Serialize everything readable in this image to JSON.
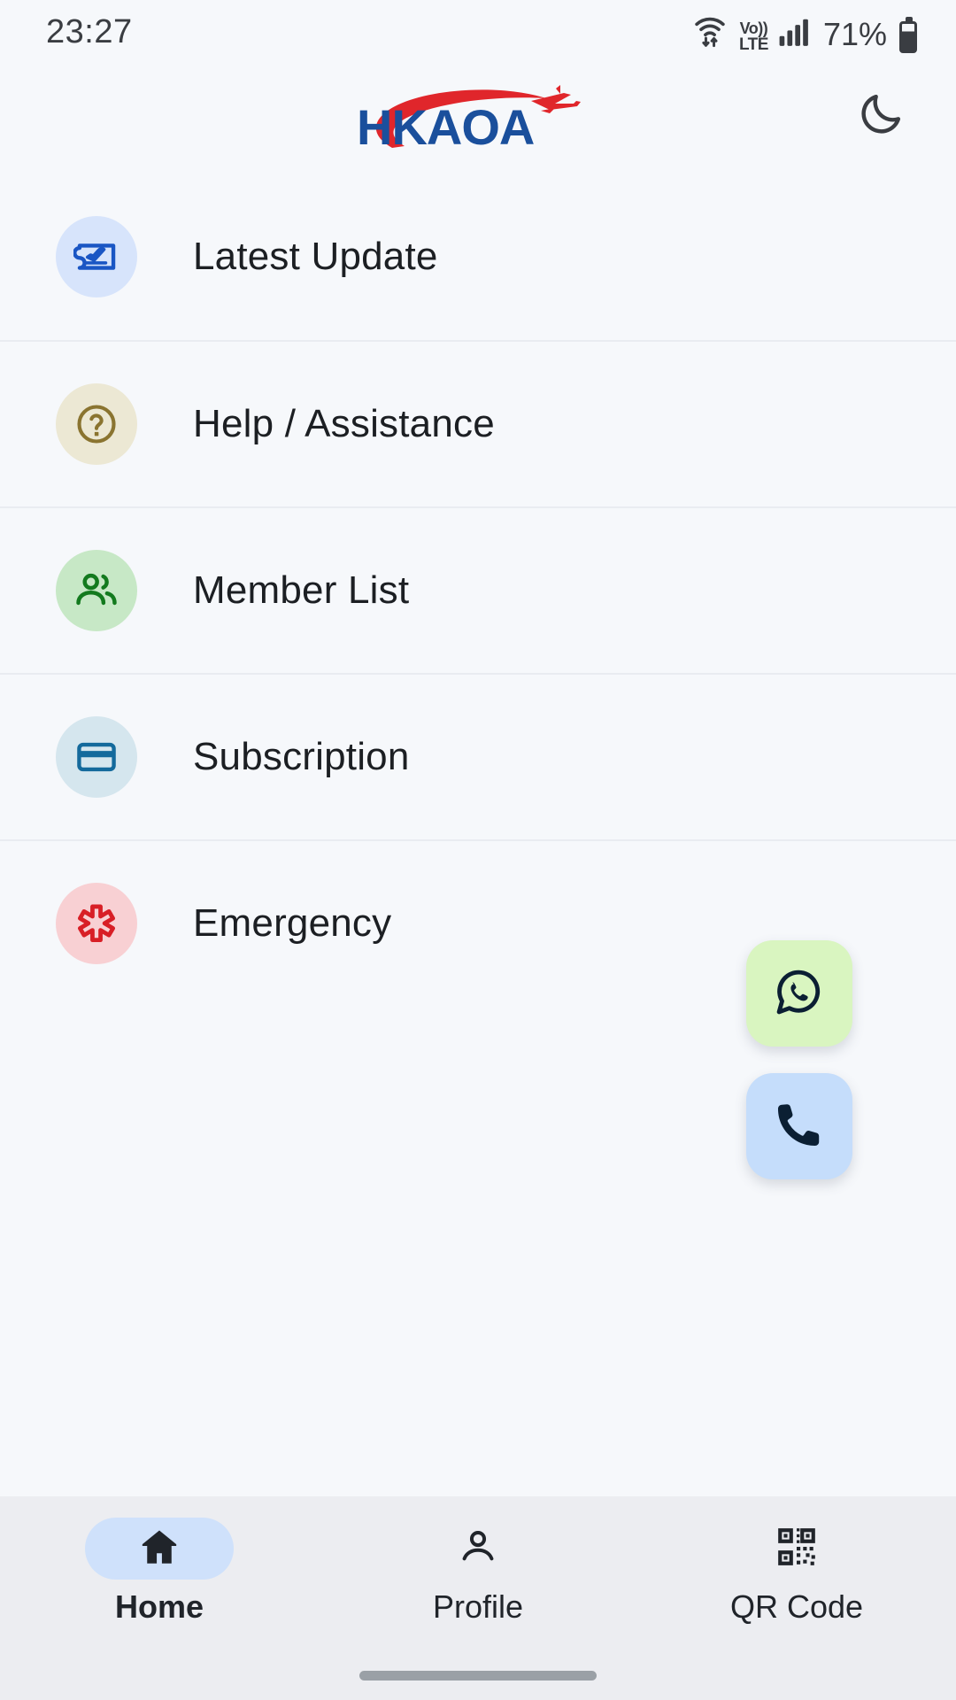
{
  "status_bar": {
    "time": "23:27",
    "volte_top": "Vo))",
    "volte_bottom": "LTE",
    "battery_percent": "71%",
    "icons": [
      "wifi-icon",
      "volte-icon",
      "cellular-signal-icon",
      "battery-icon"
    ]
  },
  "header": {
    "logo_text": "HKAOA",
    "logo_blue": "#1a4f9c",
    "logo_red": "#e0262b",
    "theme_toggle": "dark-mode-moon"
  },
  "menu": {
    "items": [
      {
        "label": "Latest Update",
        "icon": "flight-ticket-icon",
        "icon_color": "#1a56c4",
        "circle_color": "#d7e4fb"
      },
      {
        "label": "Help / Assistance",
        "icon": "question-mark-circle-icon",
        "icon_color": "#8a7430",
        "circle_color": "#ece8d4"
      },
      {
        "label": "Member List",
        "icon": "people-group-icon",
        "icon_color": "#137a1e",
        "circle_color": "#c7e8c6"
      },
      {
        "label": "Subscription",
        "icon": "credit-card-icon",
        "icon_color": "#146a9c",
        "circle_color": "#d5e6ee"
      },
      {
        "label": "Emergency",
        "icon": "star-of-life-medical-icon",
        "icon_color": "#d81f26",
        "circle_color": "#f8d0d3"
      }
    ]
  },
  "floating_buttons": [
    {
      "name": "whatsapp-button",
      "icon": "whatsapp-icon",
      "background": "#d9f5c0",
      "icon_color": "#0b1f33"
    },
    {
      "name": "call-button",
      "icon": "phone-icon",
      "background": "#c5ddfb",
      "icon_color": "#0b1f33"
    }
  ],
  "bottom_nav": {
    "items": [
      {
        "label": "Home",
        "icon": "home-icon",
        "active": true
      },
      {
        "label": "Profile",
        "icon": "person-icon",
        "active": false
      },
      {
        "label": "QR Code",
        "icon": "qr-code-icon",
        "active": false
      }
    ],
    "active_pill_color": "#cfe1fb",
    "background": "#ecedf1"
  }
}
